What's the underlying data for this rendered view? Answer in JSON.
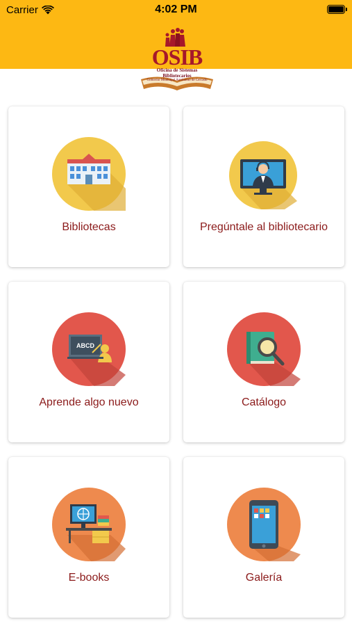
{
  "status_bar": {
    "carrier": "Carrier",
    "time": "4:02 PM"
  },
  "header": {
    "logo_title": "OSIB",
    "logo_subtitle_1": "Oficina de Sistemas",
    "logo_subtitle_2": "Bibliotecarios",
    "logo_subtitle_3": "Gobierno Municipal Autónomo de Cercado",
    "background_color": "#FDB813"
  },
  "menu": [
    {
      "label": "Bibliotecas",
      "icon": "library-building-icon",
      "circle_color": "#F2C94C"
    },
    {
      "label": "Pregúntale al bibliotecario",
      "icon": "librarian-support-icon",
      "circle_color": "#F2C94C"
    },
    {
      "label": "Aprende algo nuevo",
      "icon": "teacher-board-icon",
      "circle_color": "#E2574C"
    },
    {
      "label": "Catálogo",
      "icon": "catalog-search-icon",
      "circle_color": "#E2574C"
    },
    {
      "label": "E-books",
      "icon": "ebooks-desk-icon",
      "circle_color": "#EE8A4E"
    },
    {
      "label": "Galería",
      "icon": "gallery-tablet-icon",
      "circle_color": "#EE8A4E"
    }
  ]
}
